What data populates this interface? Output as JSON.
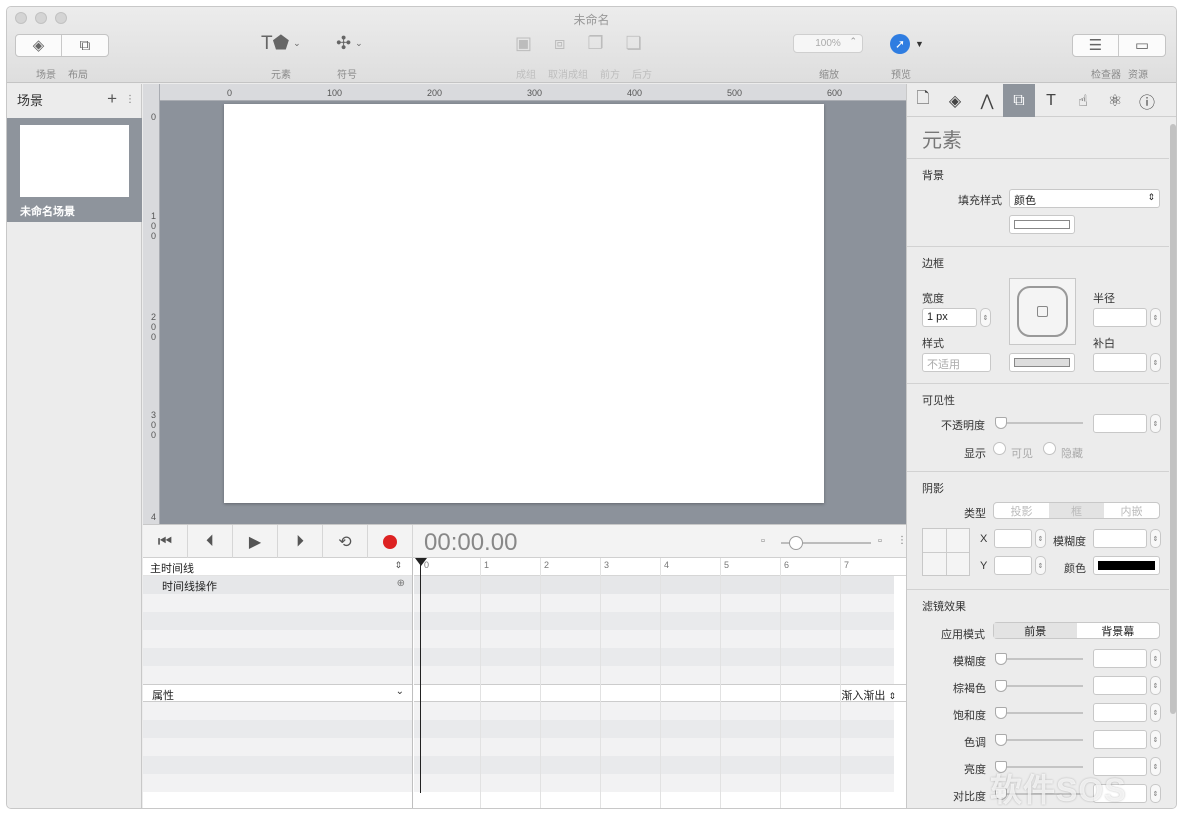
{
  "window": {
    "title": "未命名"
  },
  "toolbar": {
    "scene_label": "场景",
    "layout_label": "布局",
    "elements_label": "元素",
    "symbols_label": "符号",
    "group_label": "成组",
    "ungroup_label": "取消成组",
    "front_label": "前方",
    "back_label": "后方",
    "zoom_value": "100%",
    "zoom_label": "缩放",
    "preview_label": "预览",
    "inspector_label": "检查器",
    "resources_label": "资源"
  },
  "scenes": {
    "title": "场景",
    "add": "+",
    "items": [
      {
        "name": "未命名场景"
      }
    ]
  },
  "rulers": {
    "h": [
      "0",
      "100",
      "200",
      "300",
      "400",
      "500",
      "600"
    ],
    "v": [
      "0",
      "1\n0\n0",
      "2\n0\n0",
      "3\n0\n0",
      "4"
    ]
  },
  "timeline": {
    "timecode": "00:00.00",
    "main_timeline": "主时间线",
    "timeline_actions": "时间线操作",
    "properties": "属性",
    "easing": "渐入渐出",
    "ticks": [
      "0",
      "1",
      "2",
      "3",
      "4",
      "5",
      "6",
      "7"
    ]
  },
  "inspector": {
    "title": "元素",
    "background": {
      "heading": "背景",
      "fill_label": "填充样式",
      "fill_value": "颜色"
    },
    "border": {
      "heading": "边框",
      "width_label": "宽度",
      "width_value": "1 px",
      "style_label": "样式",
      "style_value": "不适用",
      "radius_label": "半径",
      "padding_label": "补白"
    },
    "visibility": {
      "heading": "可见性",
      "opacity_label": "不透明度",
      "display_label": "显示",
      "visible": "可见",
      "hidden": "隐藏"
    },
    "shadow": {
      "heading": "阴影",
      "type_label": "类型",
      "types": [
        "投影",
        "框",
        "内嵌"
      ],
      "x": "X",
      "y": "Y",
      "blur": "模糊度",
      "color": "颜色"
    },
    "filters": {
      "heading": "滤镜效果",
      "apply_label": "应用模式",
      "modes": [
        "前景",
        "背景幕"
      ],
      "blur": "模糊度",
      "sepia": "棕褐色",
      "saturation": "饱和度",
      "hue": "色调",
      "brightness": "亮度",
      "contrast": "对比度"
    }
  },
  "watermark": "软件SOS"
}
